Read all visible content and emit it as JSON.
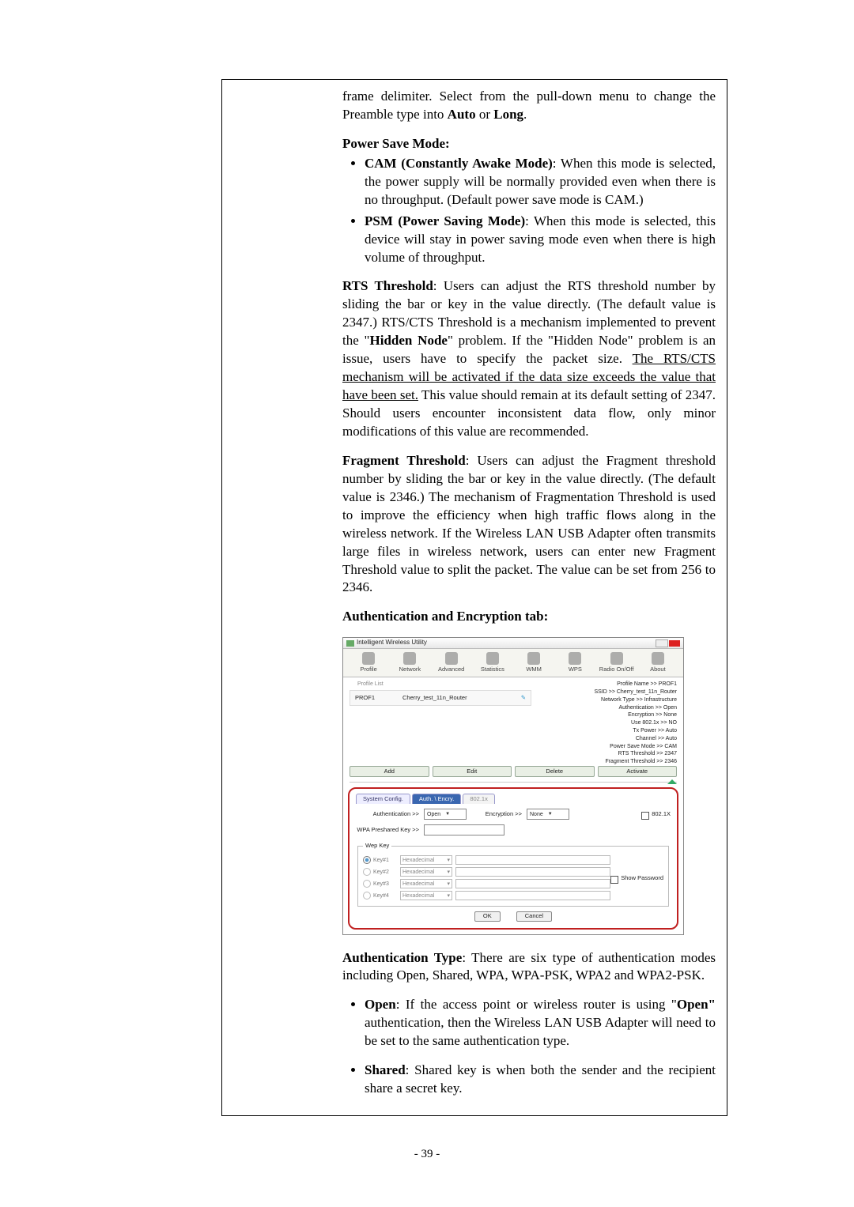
{
  "intro": "frame delimiter. Select from the pull-down menu to change the Preamble type into ",
  "intro_b1": "Auto",
  "intro_mid": " or ",
  "intro_b2": "Long",
  "intro_end": ".",
  "psm": {
    "heading": "Power Save Mode",
    "cam_b": "CAM (Constantly Awake Mode)",
    "cam_t": ": When this mode is selected, the power supply will be normally provided even when there is no throughput. (Default power save mode is CAM.)",
    "psm_b": "PSM (Power Saving Mode)",
    "psm_t": ": When this mode is selected, this device will stay in power saving mode even when there is high volume of throughput."
  },
  "rts": {
    "b": "RTS Threshold",
    "t1": ": Users can adjust the RTS threshold number by sliding the bar or key in the value directly. (The default value is 2347.) RTS/CTS Threshold is a mechanism implemented to prevent the \"",
    "hn": "Hidden Node",
    "t2": "\" problem. If the \"Hidden Node\" problem is an issue, users have to specify the packet size. ",
    "u": "The RTS/CTS mechanism will be activated if the data size exceeds the value that have been set.",
    "t3": " This value should remain at its default setting of 2347. Should users encounter inconsistent data flow, only minor modifications of this value are recommended."
  },
  "frag": {
    "b": "Fragment Threshold",
    "t": ": Users can adjust the Fragment threshold number by sliding the bar or key in the value directly. (The default value is 2346.) The mechanism of Fragmentation Threshold is used to improve the efficiency when high traffic flows along in the wireless network. If the Wireless LAN USB Adapter often transmits large files in wireless network, users can enter new Fragment Threshold value to split the packet. The value can be set from 256 to 2346."
  },
  "auth_heading": "Authentication and Encryption tab:",
  "app": {
    "title": "Intelligent Wireless Utility",
    "toolbar": [
      "Profile",
      "Network",
      "Advanced",
      "Statistics",
      "WMM",
      "WPS",
      "Radio On/Off",
      "About"
    ],
    "profile_list_label": "Profile List",
    "profile_name": "PROF1",
    "profile_ssid": "Cherry_test_11n_Router",
    "buttons": [
      "Add",
      "Edit",
      "Delete",
      "Activate"
    ],
    "details": [
      "Profile Name >> PROF1",
      "SSID >> Cherry_test_11n_Router",
      "Network Type >> Infrastructure",
      "Authentication >> Open",
      "Encryption >> None",
      "Use 802.1x >> NO",
      "Tx Power >> Auto",
      "Channel >> Auto",
      "Power Save Mode >> CAM",
      "RTS Threshold >> 2347",
      "Fragment Threshold >> 2346"
    ],
    "tabs": [
      "System Config.",
      "Auth. \\ Encry.",
      "802.1x"
    ],
    "auth_label": "Authentication >>",
    "auth_value": "Open",
    "enc_label": "Encryption >>",
    "enc_value": "None",
    "chk8021x": "802.1X",
    "wpa_label": "WPA Preshared Key >>",
    "wep_legend": "Wep Key",
    "key_labels": [
      "Key#1",
      "Key#2",
      "Key#3",
      "Key#4"
    ],
    "hex": "Hexadecimal",
    "show_password": "Show Password",
    "ok": "OK",
    "cancel": "Cancel"
  },
  "authtype": {
    "b": "Authentication Type",
    "t": ": There are six type of authentication modes including Open, Shared, WPA, WPA-PSK, WPA2 and WPA2-PSK."
  },
  "open": {
    "b": "Open",
    "t1": ": If the access point or wireless router is using \"",
    "b2": "Open\"",
    "t2": " authentication, then the Wireless LAN USB Adapter will need to be set to the same authentication type."
  },
  "shared": {
    "b": "Shared",
    "t": ": Shared key is when both the sender and the recipient share a secret key."
  },
  "pagenum": "- 39 -"
}
